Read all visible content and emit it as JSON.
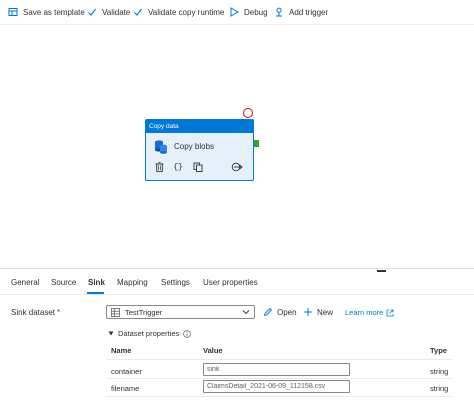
{
  "toolbar": {
    "save_template": "Save as template",
    "validate": "Validate",
    "validate_copy": "Validate copy runtime",
    "debug": "Debug",
    "add_trigger": "Add trigger"
  },
  "activity": {
    "type_label": "Copy data",
    "name": "Copy blobs",
    "type_icon": "copy-data-icon",
    "tools": [
      "delete-icon",
      "code-icon",
      "clone-icon",
      "output-arrow-icon"
    ]
  },
  "tabs": [
    {
      "label": "General",
      "active": false
    },
    {
      "label": "Source",
      "active": false
    },
    {
      "label": "Sink",
      "active": true
    },
    {
      "label": "Mapping",
      "active": false
    },
    {
      "label": "Settings",
      "active": false
    },
    {
      "label": "User properties",
      "active": false
    }
  ],
  "sink": {
    "label": "Sink dataset",
    "required_mark": "*",
    "dataset_value": "TestTrigger",
    "open_label": "Open",
    "new_label": "New",
    "learn_more": "Learn more"
  },
  "dataset_properties": {
    "title": "Dataset properties",
    "columns": {
      "name": "Name",
      "value": "Value",
      "type": "Type"
    },
    "rows": [
      {
        "name": "container",
        "value": "sink",
        "type": "string"
      },
      {
        "name": "filename",
        "value": "ClaimsDetail_2021-06-09_112158.csv",
        "type": "string"
      }
    ]
  },
  "colors": {
    "accent": "#0078d4",
    "activity_bg": "#e6f0fa",
    "success_port": "#3a9d3a",
    "error_handle": "#e00000"
  }
}
